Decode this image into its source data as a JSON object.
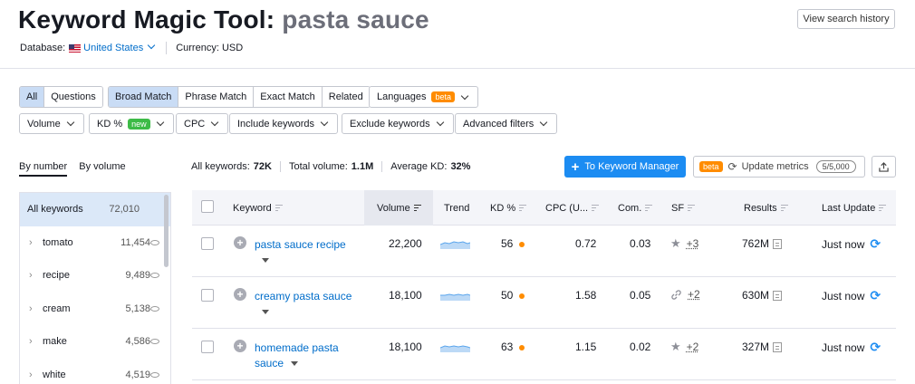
{
  "header": {
    "title_prefix": "Keyword Magic Tool:",
    "query": "pasta sauce",
    "history_button": "View search history",
    "database_label": "Database:",
    "database_value": "United States",
    "currency_label": "Currency: USD"
  },
  "filters": {
    "scope_tabs": [
      "All",
      "Questions"
    ],
    "match_tabs": [
      "Broad Match",
      "Phrase Match",
      "Exact Match",
      "Related"
    ],
    "languages": "Languages",
    "beta": "beta",
    "new": "new",
    "volume": "Volume",
    "kd": "KD %",
    "cpc": "CPC",
    "include": "Include keywords",
    "exclude": "Exclude keywords",
    "advanced": "Advanced filters"
  },
  "sort": {
    "by_number": "By number",
    "by_volume": "By volume"
  },
  "sidebar": {
    "items": [
      {
        "label": "All keywords",
        "count": "72,010"
      },
      {
        "label": "tomato",
        "count": "11,454"
      },
      {
        "label": "recipe",
        "count": "9,489"
      },
      {
        "label": "cream",
        "count": "5,138"
      },
      {
        "label": "make",
        "count": "4,586"
      },
      {
        "label": "white",
        "count": "4,519"
      }
    ]
  },
  "stats": {
    "all_keywords_label": "All keywords:",
    "all_keywords_value": "72K",
    "total_volume_label": "Total volume:",
    "total_volume_value": "1.1M",
    "avg_kd_label": "Average KD:",
    "avg_kd_value": "32%"
  },
  "actions": {
    "to_keyword_manager": "To Keyword Manager",
    "update_metrics": "Update metrics",
    "quota": "5/5,000"
  },
  "table": {
    "headers": {
      "keyword": "Keyword",
      "volume": "Volume",
      "trend": "Trend",
      "kd": "KD %",
      "cpc": "CPC (U...",
      "com": "Com.",
      "sf": "SF",
      "results": "Results",
      "last_update": "Last Update"
    },
    "rows": [
      {
        "keyword": "pasta sauce recipe",
        "volume": "22,200",
        "kd": "56",
        "cpc": "0.72",
        "com": "0.03",
        "sf_icon": "star-icon",
        "sf_more": "+3",
        "results": "762M",
        "last_update": "Just now"
      },
      {
        "keyword": "creamy pasta sauce",
        "volume": "18,100",
        "kd": "50",
        "cpc": "1.58",
        "com": "0.05",
        "sf_icon": "link-icon",
        "sf_more": "+2",
        "results": "630M",
        "last_update": "Just now"
      },
      {
        "keyword": "homemade pasta sauce",
        "volume": "18,100",
        "kd": "63",
        "cpc": "1.15",
        "com": "0.02",
        "sf_icon": "star-icon",
        "sf_more": "+2",
        "results": "327M",
        "last_update": "Just now"
      }
    ]
  },
  "colors": {
    "accent": "#1c8cf2",
    "link": "#006dca",
    "kd_dot": "#ff8c00",
    "beta": "#ff8c00",
    "new": "#3dbb47"
  }
}
